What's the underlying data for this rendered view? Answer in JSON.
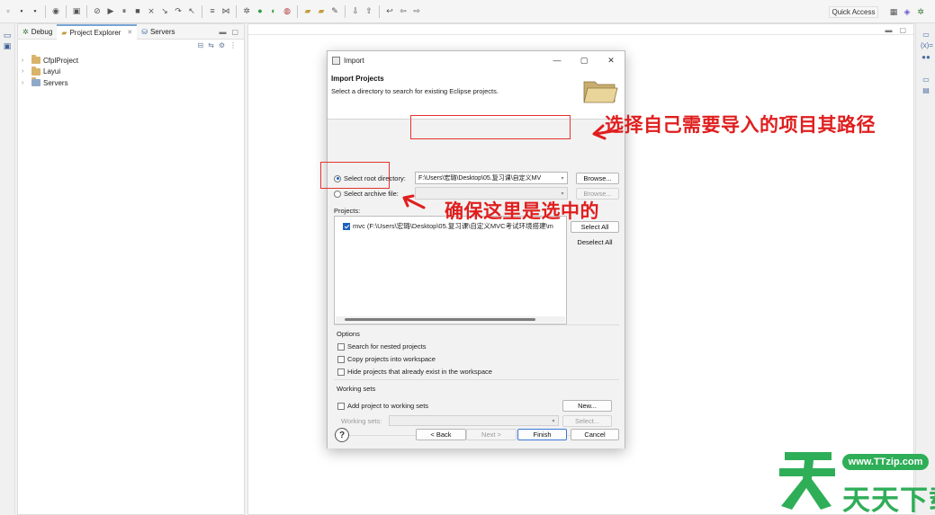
{
  "toolbar": {
    "quick_access": "Quick Access"
  },
  "explorer": {
    "tabs": [
      {
        "label": "Debug"
      },
      {
        "label": "Project Explorer",
        "close": "✕"
      },
      {
        "label": "Servers"
      }
    ],
    "tree": [
      {
        "label": "CfplProject"
      },
      {
        "label": "Layui"
      },
      {
        "label": "Servers"
      }
    ]
  },
  "dialog": {
    "title": "Import",
    "header_title": "Import Projects",
    "header_desc": "Select a directory to search for existing Eclipse projects.",
    "root_dir_label": "Select root directory:",
    "root_dir_value": "F:\\Users\\宏璐\\Desktop\\05.复习课\\自定义MV",
    "archive_label": "Select archive file:",
    "browse_label": "Browse...",
    "projects_label": "Projects:",
    "project_item": "mvc (F:\\Users\\宏璐\\Desktop\\05.复习课\\自定义MVC考试环境搭建\\m",
    "select_all": "Select All",
    "deselect_all": "Deselect All",
    "options_label": "Options",
    "opt_nested": "Search for nested projects",
    "opt_copy": "Copy projects into workspace",
    "opt_hide": "Hide projects that already exist in the workspace",
    "working_sets_label": "Working sets",
    "add_working_sets": "Add project to working sets",
    "working_sets_field": "Working sets:",
    "new_button": "New...",
    "select_button": "Select...",
    "back": "< Back",
    "next": "Next >",
    "finish": "Finish",
    "cancel": "Cancel",
    "help": "?"
  },
  "annotations": {
    "path_note": "选择自己需要导入的项目其路径",
    "check_note": "确保这里是选中的"
  },
  "watermark": {
    "url": "www.TTzip.com",
    "brand": "天天下载"
  },
  "colors": {
    "annotation_red": "#e01e1e",
    "accent_blue": "#1f5fbf",
    "watermark_green": "#2fae58"
  }
}
